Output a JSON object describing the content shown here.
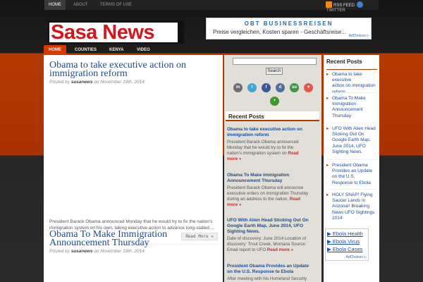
{
  "topnav": {
    "items": [
      {
        "label": "HOME"
      },
      {
        "label": "ABOUT"
      },
      {
        "label": "TERMS OF USE"
      }
    ],
    "rss_label": "RSS FEED",
    "twitter_label": "TWITTER"
  },
  "logo": {
    "text": "Sasa News"
  },
  "header_ad": {
    "title": "OBT BUSINESSREISEN",
    "text": "Preise vergleichen, Kosten sparen - Geschäftsreise...",
    "choices": "AdChoices ▷"
  },
  "mainnav": {
    "items": [
      {
        "label": "HOME"
      },
      {
        "label": "COUNTIES"
      },
      {
        "label": "KENYA"
      },
      {
        "label": "VIDEO"
      }
    ]
  },
  "posts": [
    {
      "title_line1": "Obama to take executive action on",
      "title_line2": "immigration reform",
      "meta_prefix": "Posted by",
      "author": "sasanews",
      "meta_on": "on November 19th, 2014",
      "excerpt_line1": "President Barack Obama announced Monday that he would try to fix the nation's",
      "excerpt_line2": "immigration system on his own, taking executive action to advance long-stalled ...",
      "readmore": "Read More »"
    },
    {
      "title_line1": "Obama To Make Immigration",
      "title_line2": "Announcement Thursday",
      "meta_prefix": "Posted by",
      "author": "sasanews",
      "meta_on": "on November 19th, 2014"
    }
  ],
  "search": {
    "button": "Search",
    "placeholder": ""
  },
  "social_icons": [
    {
      "icon": "myspace-icon",
      "glyph": "m",
      "color": "#6b6f73"
    },
    {
      "icon": "twitter-icon",
      "glyph": "t",
      "color": "#41a6d6"
    },
    {
      "icon": "facebook-icon",
      "glyph": "f",
      "color": "#3b5998"
    },
    {
      "icon": "delicious-icon",
      "glyph": "d",
      "color": "#4f6ea0"
    },
    {
      "icon": "stumbleupon-icon",
      "glyph": "su",
      "color": "#3a9a43"
    },
    {
      "icon": "favorite-icon",
      "glyph": "♥",
      "color": "#e45a45"
    },
    {
      "icon": "add-icon",
      "glyph": "+",
      "color": "#3a9a2f"
    }
  ],
  "recent_posts_mid": {
    "heading": "Recent Posts",
    "read_more": "Read more »",
    "items": [
      {
        "title1": "Obama to take executive action on",
        "title2": "immigration reform",
        "ex1": "President Barack Obama announced",
        "ex2": "Monday that he would try to fix the",
        "ex3": "nation's immigration system on",
        "ex3b": "Read",
        "ex4": "more »"
      },
      {
        "title1": "Obama To Make Immigration",
        "title2": "Announcement Thursday",
        "ex1": "President Barack Obama will announce",
        "ex2": "executive orders on immigration Thursday",
        "ex3": "during an address to the nation,",
        "ex3b": "Read",
        "ex4": "more »"
      },
      {
        "title1": "UFO With Alien Head Sticking Out On",
        "title2": "Google Earth Map, June 2014, UFO",
        "title3": "Sighting News.",
        "ex1": "Date of discovery: June 2014 Location of",
        "ex2": "discovery: Trout Creek, Montana Source:",
        "ex3": "Email report to UFO",
        "ex3b": "Read more »"
      },
      {
        "title1": "President Obama Provides an Update",
        "title2": "on the U.S. Response to Ebola",
        "ex1": "After meeting with his Homeland Security"
      }
    ]
  },
  "recent_posts_right": {
    "heading": "Recent Posts",
    "items": [
      [
        "Obama to take executive",
        "action on immigration",
        "reform"
      ],
      [
        "Obama To Make",
        "Immigration",
        "Announcement",
        "Thursday"
      ],
      [
        "UFO With Alien Head",
        "Sticking Out On",
        "Google Earth Map,",
        "June 2014, UFO",
        "Sighting News."
      ],
      [
        "President Obama",
        "Provides an Update",
        "on the U.S.",
        "Response to Ebola"
      ],
      [
        "HOLY SNAP! Flying",
        "Saucer Lands In",
        "Arizona!! Breaking",
        "News UFO Sightings",
        "2014"
      ]
    ]
  },
  "sidebar_ad": {
    "links": [
      "▶ Ebola Health",
      "▶ Ebola Virus",
      "▶ Ebola Cases"
    ],
    "choices": "AdChoices ▷"
  }
}
